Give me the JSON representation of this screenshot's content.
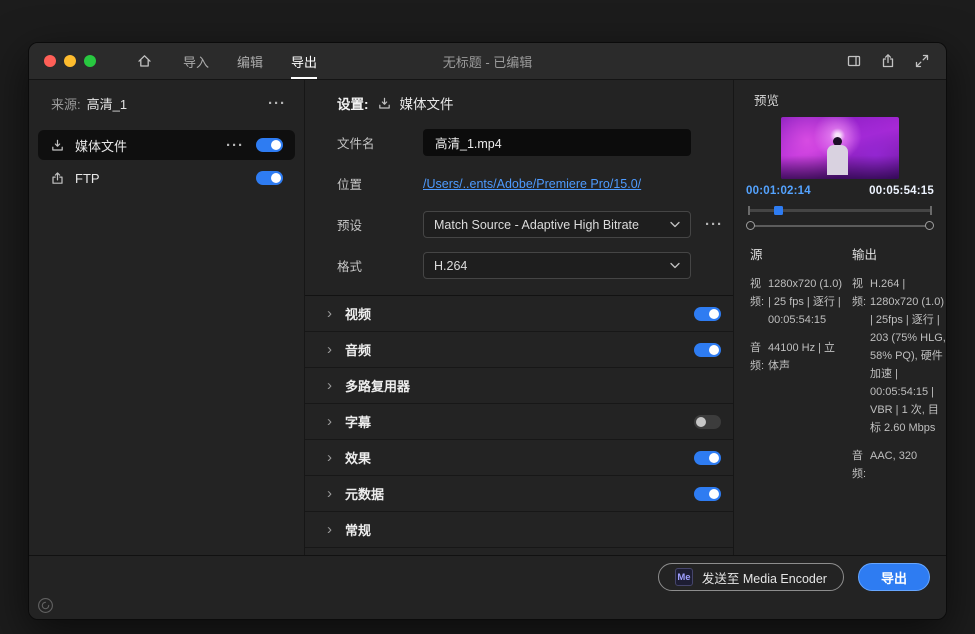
{
  "colors": {
    "accent": "#2e7cf2",
    "link": "#4e9bff",
    "timecode": "#54a3ff"
  },
  "glyphs": {
    "ellipsis": "···",
    "chevron_right": "›"
  },
  "titlebar": {
    "title": "无标题 - 已编辑",
    "tabs": [
      {
        "label": "导入",
        "active": false
      },
      {
        "label": "编辑",
        "active": false
      },
      {
        "label": "导出",
        "active": true
      }
    ]
  },
  "sidebar": {
    "source_label": "来源:",
    "source_name": "高清_1",
    "items": [
      {
        "label": "媒体文件",
        "toggle": "on",
        "selected": true
      },
      {
        "label": "FTP",
        "toggle": "on",
        "selected": false
      }
    ]
  },
  "settings": {
    "header_label": "设置:",
    "header_value": "媒体文件",
    "filename_label": "文件名",
    "filename_value": "高清_1.mp4",
    "location_label": "位置",
    "location_value": "/Users/..ents/Adobe/Premiere Pro/15.0/",
    "preset_label": "预设",
    "preset_value": "Match Source - Adaptive High Bitrate",
    "format_label": "格式",
    "format_value": "H.264",
    "sections": [
      {
        "label": "视频",
        "toggle": "on"
      },
      {
        "label": "音频",
        "toggle": "on"
      },
      {
        "label": "多路复用器",
        "toggle": "none"
      },
      {
        "label": "字幕",
        "toggle": "off"
      },
      {
        "label": "效果",
        "toggle": "on"
      },
      {
        "label": "元数据",
        "toggle": "on"
      },
      {
        "label": "常规",
        "toggle": "none"
      }
    ]
  },
  "preview": {
    "title": "预览",
    "time_current": "00:01:02:14",
    "time_total": "00:05:54:15",
    "source": {
      "header": "源",
      "rows": [
        {
          "key": "视频:",
          "value": "1280x720 (1.0) | 25 fps | 逐行 | 00:05:54:15"
        },
        {
          "key": "音频:",
          "value": "44100 Hz | 立体声"
        }
      ]
    },
    "output": {
      "header": "输出",
      "rows": [
        {
          "key": "视频:",
          "value": "H.264 | 1280x720 (1.0) | 25fps | 逐行 | 203 (75% HLG, 58% PQ), 硬件加速 | 00:05:54:15 | VBR | 1 次, 目标 2.60 Mbps"
        },
        {
          "key": "音频:",
          "value": "AAC, 320"
        }
      ]
    }
  },
  "footer": {
    "me_badge": "Me",
    "send_button": "发送至 Media Encoder",
    "export_button": "导出"
  }
}
